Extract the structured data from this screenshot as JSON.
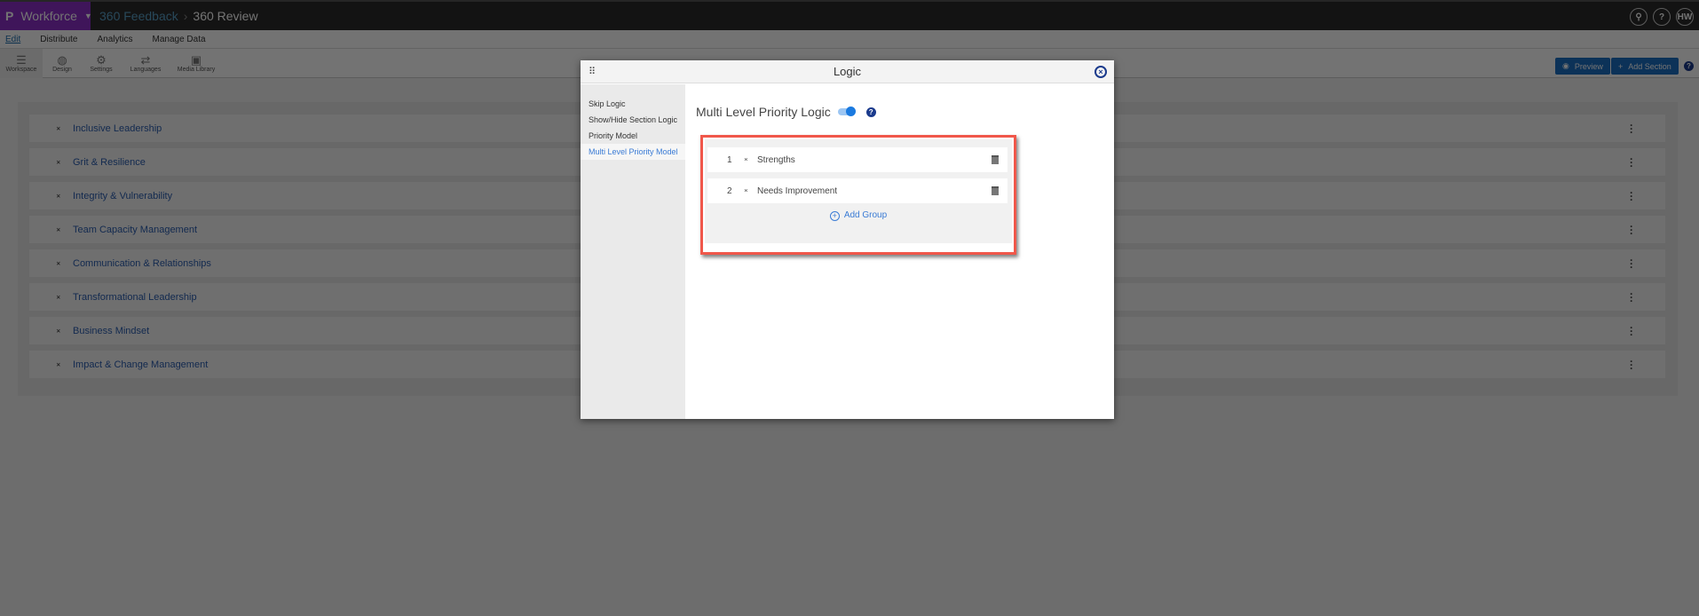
{
  "topbar": {
    "brand": "Workforce",
    "breadcrumb": [
      "360 Feedback",
      "360 Review"
    ],
    "user_initials": "HW"
  },
  "menu": [
    "Edit",
    "Distribute",
    "Analytics",
    "Manage Data"
  ],
  "toolbar": {
    "tools": [
      "Workspace",
      "Design",
      "Settings",
      "Languages",
      "Media Library"
    ],
    "preview": "Preview",
    "add_section": "Add Section"
  },
  "sections": [
    "Inclusive Leadership",
    "Grit & Resilience",
    "Integrity & Vulnerability",
    "Team Capacity Management",
    "Communication & Relationships",
    "Transformational Leadership",
    "Business Mindset",
    "Impact & Change Management"
  ],
  "modal": {
    "title": "Logic",
    "sidebar": [
      "Skip Logic",
      "Show/Hide Section Logic",
      "Priority Model",
      "Multi Level Priority Model"
    ],
    "heading": "Multi Level Priority Logic",
    "toggle_on": true,
    "groups": [
      {
        "num": "1",
        "name": "Strengths"
      },
      {
        "num": "2",
        "name": "Needs Improvement"
      }
    ],
    "add_group": "Add Group"
  }
}
